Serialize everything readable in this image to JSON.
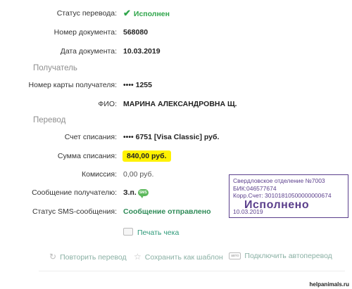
{
  "details": {
    "status_label": "Статус перевода:",
    "status_value": "Исполнен",
    "doc_number_label": "Номер документа:",
    "doc_number_value": "568080",
    "doc_date_label": "Дата документа:",
    "doc_date_value": "10.03.2019"
  },
  "recipient": {
    "section_title": "Получатель",
    "card_label": "Номер карты получателя:",
    "card_value": "•••• 1255",
    "name_label": "ФИО:",
    "name_value": "МАРИНА АЛЕКСАНДРОВНА Щ."
  },
  "transfer": {
    "section_title": "Перевод",
    "account_label": "Счет списания:",
    "account_value": "•••• 6751  [Visa Classic]  руб.",
    "amount_label": "Сумма списания:",
    "amount_value": "840,00  руб.",
    "commission_label": "Комиссия:",
    "commission_value": "0,00 руб.",
    "message_label": "Сообщение получателю:",
    "message_value": "З.п.",
    "sms_label": "Статус SMS-сообщения:",
    "sms_value": "Сообщение отправлено",
    "print_label": "Печать чека"
  },
  "stamp": {
    "line1": "Свердловское отделение №7003",
    "line2": "БИК:046577674",
    "line3": "Корр.Счет: 30101810500000000674",
    "status": "Исполнено",
    "date": "10.03.2019",
    "color": "#5b3f8c"
  },
  "actions": {
    "repeat": "Повторить перевод",
    "save_template": "Сохранить как шаблон",
    "avto_badge": "авто",
    "autopay": "Подключить автоперевод"
  },
  "watermark": "helpanimals.ru",
  "colors": {
    "accent_green": "#2ea54a",
    "highlight": "#fff200"
  }
}
